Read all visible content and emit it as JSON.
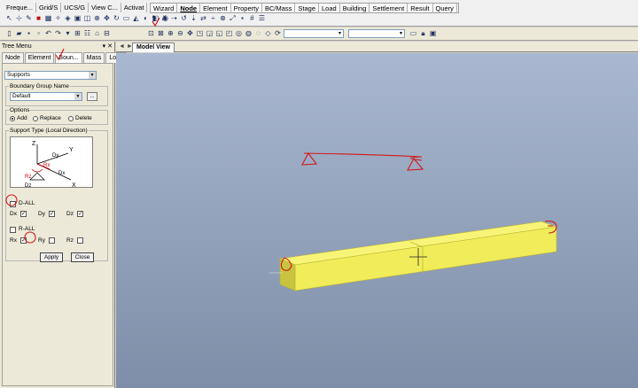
{
  "ribbon": {
    "left_tabs": [
      "Freque...",
      "Grid/S",
      "UCS/G",
      "View C...",
      "Activat"
    ],
    "right_tabs": [
      "Wizard",
      "Node",
      "Element",
      "Property",
      "BC/Mass",
      "Stage",
      "Load",
      "Building",
      "Settlement",
      "Result",
      "Query"
    ],
    "active_right_tab": "Node"
  },
  "panel": {
    "title": "Tree Menu",
    "pin_glyph": "▾ ✕",
    "tabs": [
      "Node",
      "Element",
      "Boun...",
      "Mass",
      "Load"
    ],
    "active_tab": "Boun...",
    "function_select": "Supports",
    "boundary_group": {
      "legend": "Boundary Group Name",
      "value": "Default",
      "dots": "..."
    },
    "options": {
      "legend": "Options",
      "items": [
        "Add",
        "Replace",
        "Delete"
      ],
      "selected": "Add"
    },
    "support_type": {
      "legend": "Support Type (Local Direction)",
      "d_all_label": "D-ALL",
      "r_all_label": "R-ALL",
      "d_items": [
        {
          "label": "Dx",
          "checked": true
        },
        {
          "label": "Dy",
          "checked": true
        },
        {
          "label": "Dz",
          "checked": true
        }
      ],
      "r_items": [
        {
          "label": "Rx",
          "checked": true
        },
        {
          "label": "Ry",
          "checked": false
        },
        {
          "label": "Rz",
          "checked": false
        }
      ],
      "diagram_labels": {
        "z": "Z",
        "y": "Y",
        "x": "X",
        "dy": "Dy",
        "dx": "Dx",
        "dz": "Dz",
        "rx": "Rx",
        "rz": "Rz"
      }
    },
    "apply_label": "Apply",
    "close_label": "Close"
  },
  "model_view": {
    "nav": "◄ ►",
    "tab_label": "Model View"
  },
  "colors": {
    "beam_top": "#f8f478",
    "beam_front": "#f0ec5a",
    "beam_end": "#c8c440",
    "annotation": "#d01818",
    "viewport_top": "#a9b8d0",
    "viewport_bottom": "#7f8ea8"
  }
}
